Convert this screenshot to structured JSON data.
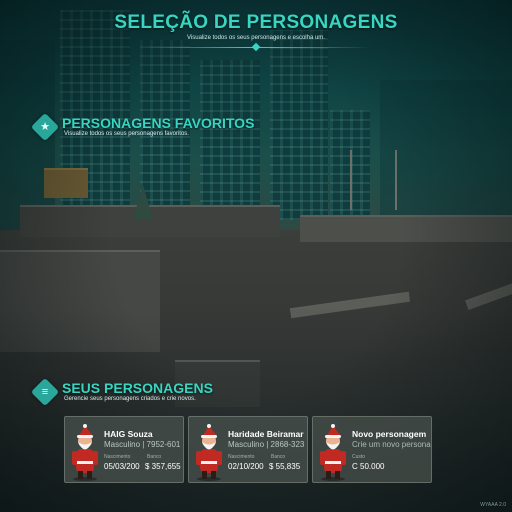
{
  "header": {
    "title": "SELEÇÃO DE PERSONAGENS",
    "subtitle": "Visualize todos os seus personagens e escolha um."
  },
  "favorites": {
    "icon": "star-icon",
    "title": "PERSONAGENS FAVORITOS",
    "subtitle": "Visualize todos os seus personagens favoritos."
  },
  "mine": {
    "icon": "list-icon",
    "title": "SEUS PERSONAGENS",
    "subtitle": "Gerencie seus personagens criados e crie novos.",
    "characters": [
      {
        "name": "HAIG Souza",
        "meta": "Masculino | 7952-601",
        "birth_label": "Nascimento",
        "bank_label": "Banco",
        "birth": "05/03/200",
        "bank": "$ 357,655",
        "avatar": "santa-avatar"
      },
      {
        "name": "Haridade Beiramar",
        "meta": "Masculino | 2868-323",
        "birth_label": "Nascimento",
        "bank_label": "Banco",
        "birth": "02/10/200",
        "bank": "$ 55,835",
        "avatar": "santa-avatar"
      }
    ],
    "new_character": {
      "name": "Novo personagem",
      "meta": "Crie um novo personagem.",
      "cost_label": "Custo",
      "cost": "C 50.000",
      "avatar": "santa-avatar"
    }
  },
  "version": "WYAAA 2.0",
  "colors": {
    "accent": "#38d5c2",
    "icon_bg": "#2aa79a",
    "card_bg": "#464e4a"
  }
}
